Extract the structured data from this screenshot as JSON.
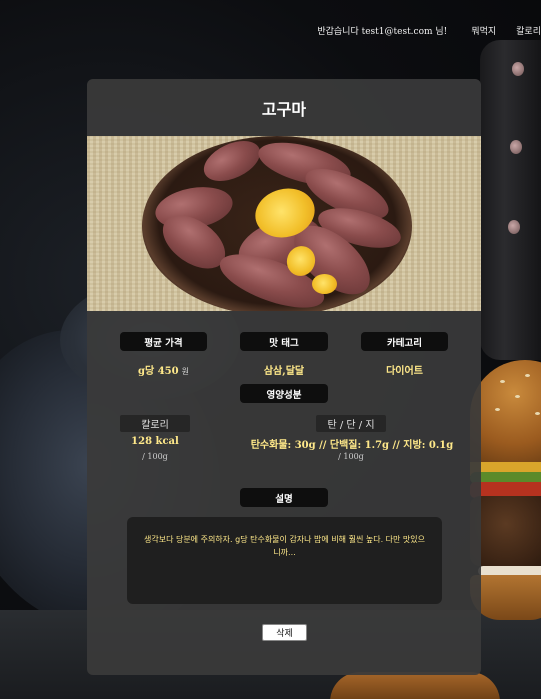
{
  "nav": {
    "greeting": "반갑습니다 test1@test.com 님!",
    "links": [
      "뭐먹지",
      "칼로리"
    ]
  },
  "food": {
    "title": "고구마",
    "image_alt": "고구마 사진"
  },
  "info": {
    "price_label": "평균 가격",
    "price_value": "g당 450",
    "price_unit": "원",
    "taste_label": "맛 태그",
    "taste_value": "삼삼,달달",
    "category_label": "카테고리",
    "category_value": "다이어트"
  },
  "nutrition": {
    "label": "영양성분",
    "calorie_label": "칼로리",
    "calorie_value": "128 kcal",
    "calorie_per": "/ 100g",
    "macro_label": "탄 / 단 / 지",
    "macro_value": "탄수화물: 30g // 단백질: 1.7g // 지방: 0.1g",
    "macro_per": "/ 100g"
  },
  "description": {
    "label": "설명",
    "text": "생각보다 당분에 주의하자. g당 탄수화물이 감자나 밥에 비해 훨씬 높다. 다만 맛있으니까..."
  },
  "actions": {
    "delete_label": "삭제"
  },
  "colors": {
    "accent_text": "#ffe98a",
    "card_bg": "#3a3a3a",
    "pill_bg": "#0e0e0e"
  }
}
